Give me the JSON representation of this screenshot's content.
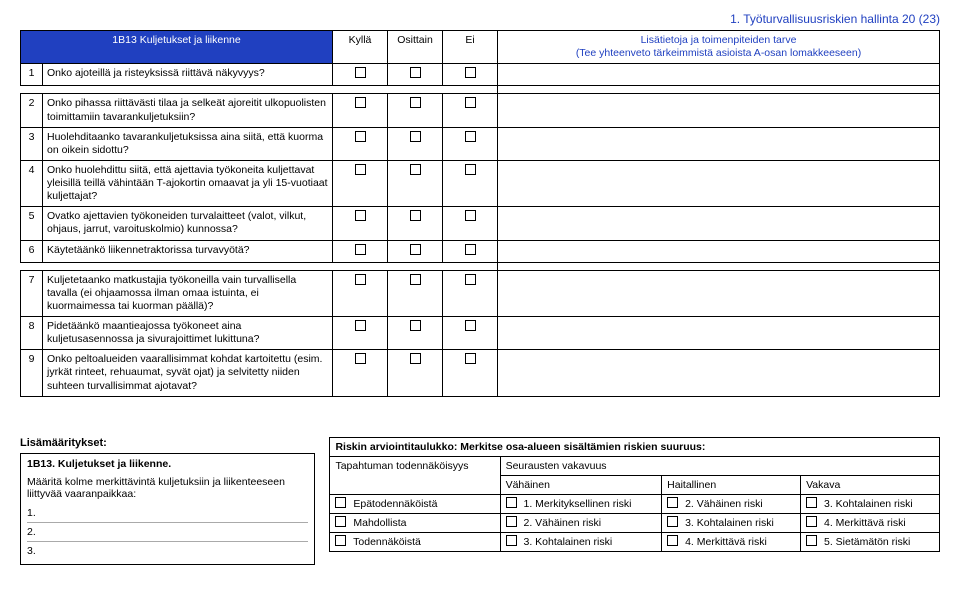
{
  "header": "1. Työturvallisuusriskien hallinta 20 (23)",
  "section_title": "1B13 Kuljetukset ja liikenne",
  "cols": {
    "c1": "Kyllä",
    "c2": "Osittain",
    "c3": "Ei"
  },
  "info_hdr_line1": "Lisätietoja ja toimenpiteiden tarve",
  "info_hdr_line2": "(Tee yhteenveto tärkeimmistä asioista A-osan lomakkeeseen)",
  "rows": [
    {
      "n": "1",
      "q": "Onko ajoteillä ja risteyksissä riittävä näkyvyys?"
    },
    {
      "n": "2",
      "q": "Onko pihassa riittävästi tilaa ja selkeät ajoreitit ulkopuolisten toimittamiin tavarankuljetuksiin?"
    },
    {
      "n": "3",
      "q": "Huolehditaanko tavarankuljetuksissa aina siitä, että kuorma on oikein sidottu?"
    },
    {
      "n": "4",
      "q": "Onko huolehdittu siitä, että ajettavia työkoneita kuljettavat yleisillä teillä vähintään T-ajokortin omaavat ja yli 15-vuotiaat kuljettajat?"
    },
    {
      "n": "5",
      "q": "Ovatko ajettavien työkoneiden turvalaitteet (valot, vilkut, ohjaus, jarrut, varoituskolmio) kunnossa?"
    },
    {
      "n": "6",
      "q": "Käytetäänkö liikennetraktorissa turvavyötä?"
    },
    {
      "n": "7",
      "q": "Kuljetetaanko matkustajia työkoneilla vain turvallisella tavalla (ei ohjaamossa ilman omaa istuinta, ei kuormaimessa tai kuorman päällä)?"
    },
    {
      "n": "8",
      "q": "Pidetäänkö maantieajossa työkoneet aina kuljetusasennossa ja sivurajoittimet lukittuna?"
    },
    {
      "n": "9",
      "q": "Onko peltoalueiden vaarallisimmat kohdat kartoitettu (esim. jyrkät rinteet, rehuaumat, syvät ojat) ja selvitetty niiden suhteen turvallisimmat ajotavat?"
    }
  ],
  "lisam_label": "Lisämääritykset:",
  "lisam_title": "1B13. Kuljetukset ja liikenne.",
  "lisam_instr": "Määritä kolme merkittävintä kuljetuksiin ja liikenteeseen liittyvää vaaranpaikkaa:",
  "haz": [
    "1.",
    "2.",
    "3."
  ],
  "risk": {
    "title": "Riskin arviointitaulukko: Merkitse osa-alueen sisältämien riskien suuruus:",
    "row_hdr": "Tapahtuman todennäköisyys",
    "col_hdr": "Seurausten vakavuus",
    "cols": [
      "Vähäinen",
      "Haitallinen",
      "Vakava"
    ],
    "rows": [
      "Epätodennäköistä",
      "Mahdollista",
      "Todennäköistä"
    ],
    "cells": [
      [
        "1. Merkityksellinen riski",
        "2. Vähäinen riski",
        "3. Kohtalainen riski"
      ],
      [
        "2. Vähäinen riski",
        "3. Kohtalainen riski",
        "4. Merkittävä riski"
      ],
      [
        "3. Kohtalainen riski",
        "4. Merkittävä riski",
        "5. Sietämätön riski"
      ]
    ]
  }
}
